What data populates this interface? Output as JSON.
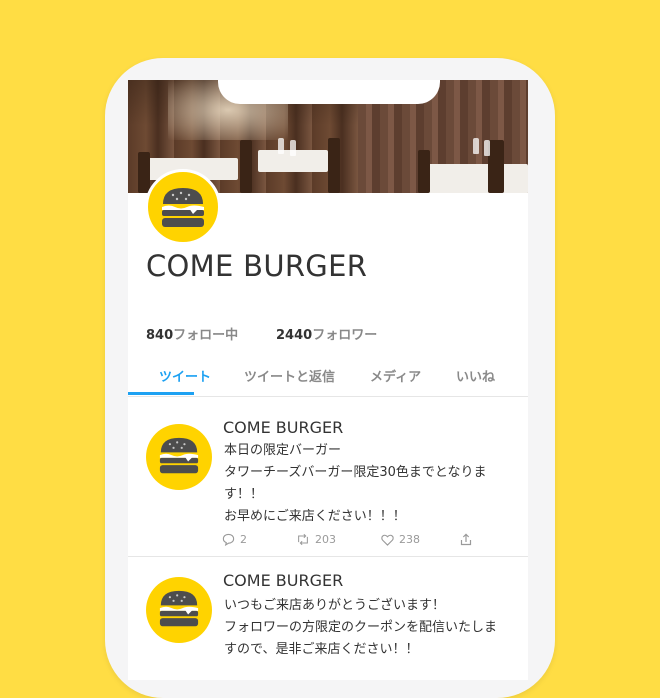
{
  "profile": {
    "name": "COME BURGER",
    "following_count": "840",
    "following_label": "フォロー中",
    "followers_count": "2440",
    "followers_label": "フォロワー"
  },
  "tabs": [
    {
      "label": "ツイート",
      "active": true
    },
    {
      "label": "ツイートと返信",
      "active": false
    },
    {
      "label": "メディア",
      "active": false
    },
    {
      "label": "いいね",
      "active": false
    }
  ],
  "tweets": [
    {
      "author": "COME BURGER",
      "text": "本日の限定バーガー\nタワーチーズバーガー限定30色までとなります！！\nお早めにご来店ください！！！",
      "replies": "2",
      "retweets": "203",
      "likes": "238"
    },
    {
      "author": "COME BURGER",
      "text": "いつもご来店ありがとうございます！\nフォロワーの方限定のクーポンを配信いたしますので、是非ご来店ください！！"
    }
  ],
  "colors": {
    "background": "#FFDD44",
    "avatar": "#FFD300",
    "accent": "#1da1f2"
  }
}
